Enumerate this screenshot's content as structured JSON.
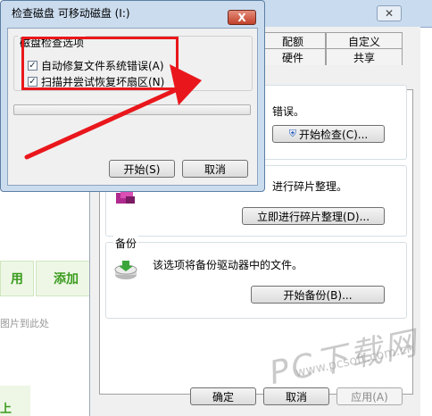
{
  "background": {
    "green_button_1": "用",
    "green_button_2": "添加",
    "hint_text": "图片到此处",
    "bottom_label": "上"
  },
  "properties_dialog": {
    "tabs_row1": [
      "配额",
      "自定义"
    ],
    "tabs_row2": [
      "硬件",
      "共享"
    ],
    "error_check_text": "错误。",
    "error_check_button": "开始检查(C)...",
    "defrag_text": "进行碎片整理。",
    "defrag_button": "立即进行碎片整理(D)...",
    "backup_title": "备份",
    "backup_text": "该选项将备份驱动器中的文件。",
    "backup_button": "开始备份(B)...",
    "ok_button": "确定",
    "cancel_button": "取消",
    "apply_button": "应用(A)"
  },
  "check_disk_dialog": {
    "title": "检查磁盘 可移动磁盘 (I:)",
    "close_label": "X",
    "options_title": "磁盘检查选项",
    "options": [
      {
        "label": "自动修复文件系统错误(A)",
        "checked": true
      },
      {
        "label": "扫描并尝试恢复坏扇区(N)",
        "checked": true
      }
    ],
    "start_button": "开始(S)",
    "cancel_button": "取消"
  },
  "watermark": {
    "brand": "PC下载网",
    "url": "www.pcsoft.com.cn"
  },
  "colors": {
    "highlight": "#e9171c",
    "title_bar": "#cbdcef",
    "close_button": "#c1412a"
  }
}
